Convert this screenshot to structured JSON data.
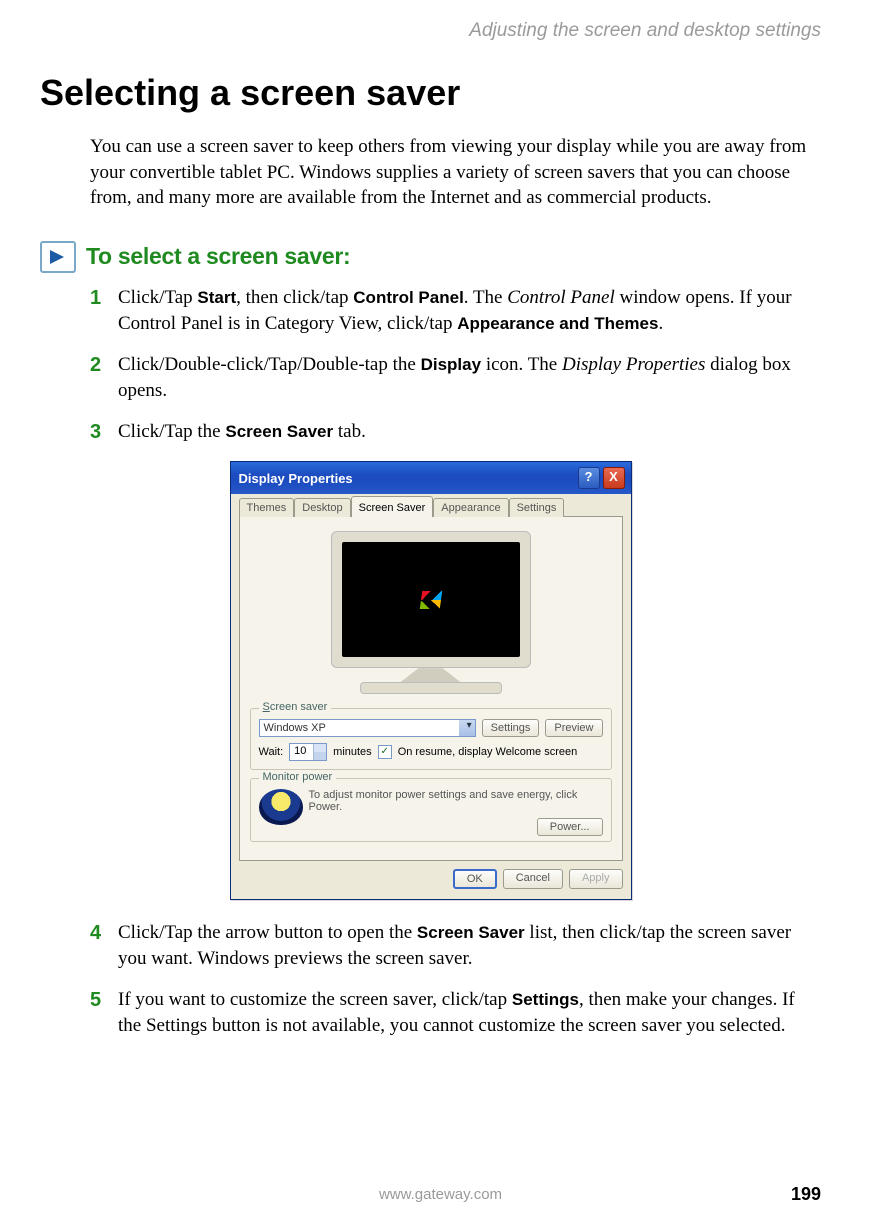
{
  "running_head": "Adjusting the screen and desktop settings",
  "section_title": "Selecting a screen saver",
  "intro": "You can use a screen saver to keep others from viewing your display while you are away from your convertible tablet PC. Windows supplies a variety of screen savers that you can choose from, and many more are available from the Internet and as commercial products.",
  "procedure_heading": "To select a screen saver:",
  "steps": {
    "s1": {
      "pre1": "Click/Tap ",
      "b1": "Start",
      "mid1": ", then click/tap ",
      "b2": "Control Panel",
      "mid2": ". The ",
      "i1": "Control Panel",
      "mid3": " window opens. If your Control Panel is in Category View, click/tap ",
      "b3": "Appearance and Themes",
      "post": "."
    },
    "s2": {
      "pre1": "Click/Double-click/Tap/Double-tap the ",
      "b1": "Display",
      "mid1": " icon. The ",
      "i1": "Display Properties",
      "post": " dialog box opens."
    },
    "s3": {
      "pre1": "Click/Tap the ",
      "b1": "Screen Saver",
      "post": " tab."
    },
    "s4": {
      "pre1": "Click/Tap the arrow button to open the ",
      "b1": "Screen Saver",
      "post": " list, then click/tap the screen saver you want. Windows previews the screen saver."
    },
    "s5": {
      "pre1": "If you want to customize the screen saver, click/tap ",
      "b1": "Settings",
      "post": ", then make your changes. If the Settings button is not available, you cannot customize the screen saver you selected."
    }
  },
  "dialog": {
    "title": "Display Properties",
    "help_glyph": "?",
    "close_glyph": "X",
    "tabs": [
      "Themes",
      "Desktop",
      "Screen Saver",
      "Appearance",
      "Settings"
    ],
    "active_tab_index": 2,
    "screensaver_group": {
      "legend_accel": "S",
      "legend_rest": "creen saver",
      "select_value": "Windows XP",
      "settings_btn": "Settings",
      "preview_btn": "Preview",
      "wait_label": "Wait:",
      "wait_value": "10",
      "minutes_label": "minutes",
      "check_glyph": "✓",
      "resume_label": "On resume, display Welcome screen"
    },
    "monitor_group": {
      "legend": "Monitor power",
      "text": "To adjust monitor power settings and save energy, click Power.",
      "power_btn": "Power..."
    },
    "buttons": {
      "ok": "OK",
      "cancel": "Cancel",
      "apply": "Apply"
    }
  },
  "footer": {
    "url": "www.gateway.com",
    "page": "199"
  }
}
